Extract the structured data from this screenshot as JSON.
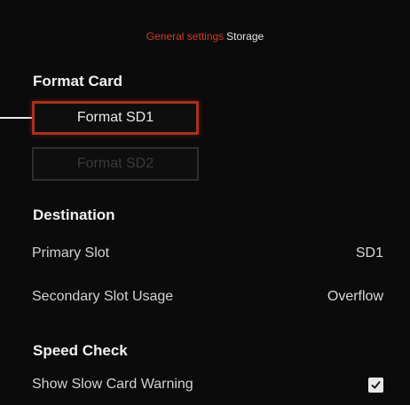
{
  "breadcrumb": {
    "parent": "General settings",
    "current": "Storage"
  },
  "format_card": {
    "title": "Format Card",
    "button_sd1": "Format SD1",
    "button_sd2": "Format SD2"
  },
  "destination": {
    "title": "Destination",
    "primary_slot_label": "Primary Slot",
    "primary_slot_value": "SD1",
    "secondary_usage_label": "Secondary Slot Usage",
    "secondary_usage_value": "Overflow"
  },
  "speed_check": {
    "title": "Speed Check",
    "slow_warning_label": "Show Slow Card Warning",
    "slow_warning_checked": true
  },
  "colors": {
    "accent": "#d23a2a",
    "focus_border": "#a8321e",
    "background": "#0b0b0b"
  }
}
